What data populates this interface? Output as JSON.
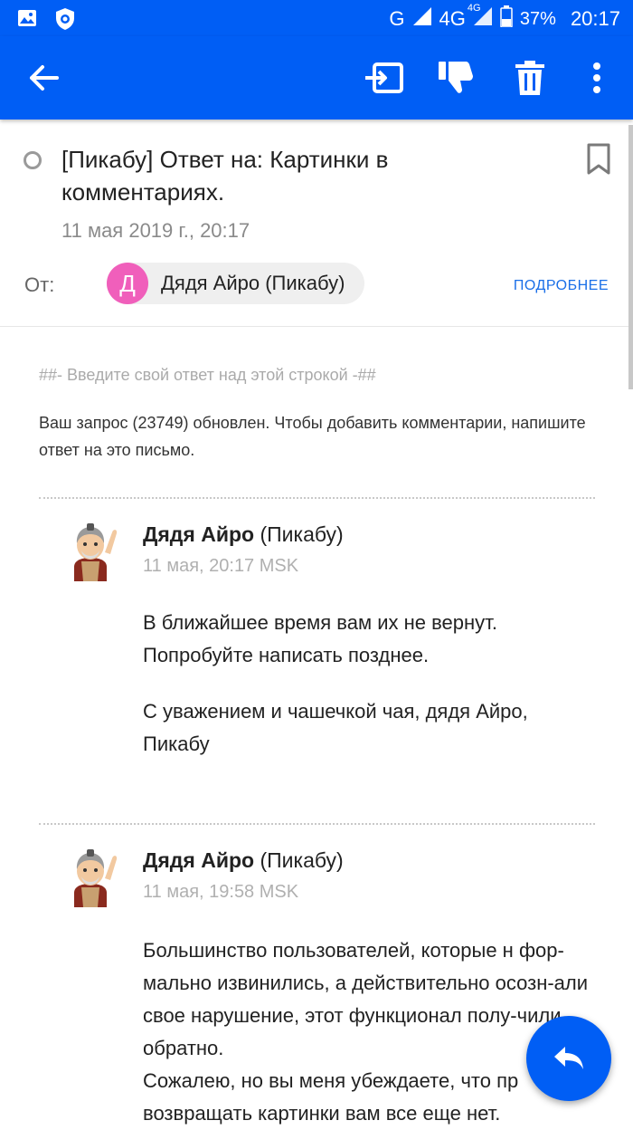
{
  "status_bar": {
    "network_g": "G",
    "network_4g": "4G",
    "network_4g_small": "4G",
    "battery": "37%",
    "time": "20:17"
  },
  "toolbar": {
    "icons": [
      "back-arrow-icon",
      "move-to-folder-icon",
      "spam-thumbs-down-icon",
      "trash-icon",
      "more-vert-icon"
    ]
  },
  "message": {
    "subject": "[Пикабу] Ответ на: Картинки в комментариях.",
    "date": "11 мая 2019 г., 20:17",
    "from_label": "От:",
    "sender_initial": "Д",
    "sender_name": "Дядя Айро (Пикабу)",
    "more_link": "ПОДРОБНЕЕ"
  },
  "body": {
    "reply_line": "##- Введите свой ответ над этой строкой -##",
    "intro": "Ваш запрос (23749) обновлен. Чтобы добавить комментарии, напишите ответ на это письмо.",
    "comments": [
      {
        "author_bold": "Дядя Айро",
        "author_rest": " (Пикабу)",
        "time": "11 мая, 20:17 MSK",
        "paragraphs": [
          "В ближайшее время вам их не вернут. Попробуйте написать позднее.",
          "С уважением и чашечкой чая, дядя Айро, Пикабу"
        ]
      },
      {
        "author_bold": "Дядя Айро",
        "author_rest": " (Пикабу)",
        "time": "11 мая, 19:58 MSK",
        "paragraphs": [
          "Большинство пользователей, которые н фор-мально извинились, а действительно осозн-али свое нарушение, этот функционал полу-чили обратно.",
          "Сожалею, но вы меня убеждаете, что пр возвращать картинки вам все еще нет."
        ]
      }
    ]
  },
  "colors": {
    "brand_blue": "#005ef5",
    "avatar_pink": "#f05fbb",
    "link_blue": "#1a6fe8"
  }
}
